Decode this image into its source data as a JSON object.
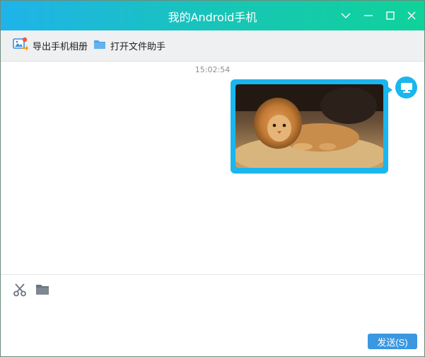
{
  "window": {
    "title": "我的Android手机",
    "controls": [
      "chevron-down-icon",
      "minimize-icon",
      "maximize-icon",
      "close-icon"
    ]
  },
  "toolbar": {
    "export_album_label": "导出手机相册",
    "open_file_assistant_label": "打开文件助手"
  },
  "chat": {
    "timestamp": "15:02:54",
    "messages": [
      {
        "type": "image",
        "content": "photo of a cat wearing a lion mane costume lying on a bed",
        "sender": "computer"
      }
    ]
  },
  "composer": {
    "placeholder": "",
    "value": "",
    "tools": [
      "scissors-icon",
      "folder-icon"
    ],
    "send_label": "发送(S)"
  },
  "colors": {
    "title_gradient_start": "#1fb3ea",
    "title_gradient_end": "#0fd29a",
    "bubble": "#1ab6ee",
    "send_button": "#3a97e0"
  }
}
